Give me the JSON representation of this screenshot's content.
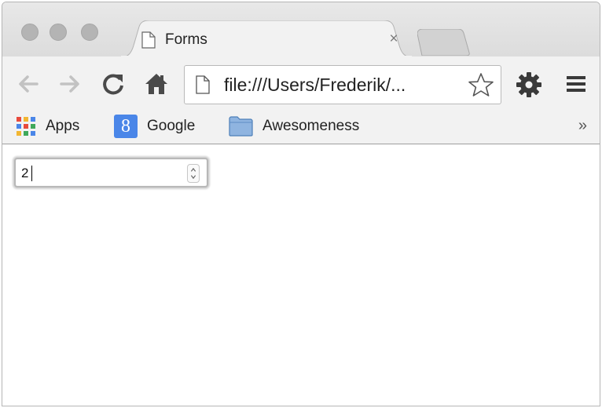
{
  "tab": {
    "title": "Forms",
    "close_glyph": "×"
  },
  "omnibox": {
    "url": "file:///Users/Frederik/..."
  },
  "bookmarks": [
    {
      "label": "Apps",
      "icon": "apps-grid-icon"
    },
    {
      "label": "Google",
      "icon": "google-icon",
      "icon_glyph": "8"
    },
    {
      "label": "Awesomeness",
      "icon": "folder-icon"
    }
  ],
  "bookmarks_more": "»",
  "form": {
    "number_value": "2"
  },
  "colors": {
    "titlebar": "#dcdcdc",
    "toolbar": "#f2f2f2",
    "google_blue": "#4a86e8",
    "traffic_light": "#b4b4b4"
  }
}
